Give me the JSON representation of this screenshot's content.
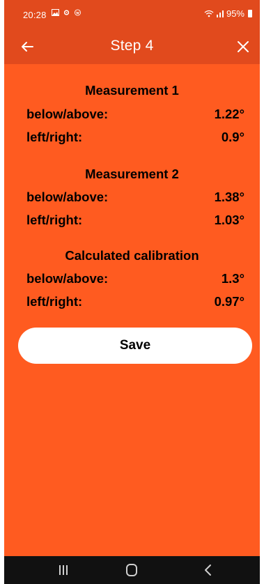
{
  "status_bar": {
    "time": "20:28",
    "battery": "95%"
  },
  "app_bar": {
    "title": "Step 4",
    "back_icon": "arrow-left-icon",
    "close_icon": "close-icon"
  },
  "measurements": [
    {
      "title": "Measurement 1",
      "rows": [
        {
          "label": "below/above:",
          "value": "1.22°"
        },
        {
          "label": "left/right:",
          "value": "0.9°"
        }
      ]
    },
    {
      "title": "Measurement 2",
      "rows": [
        {
          "label": "below/above:",
          "value": "1.38°"
        },
        {
          "label": "left/right:",
          "value": "1.03°"
        }
      ]
    },
    {
      "title": "Calculated calibration",
      "rows": [
        {
          "label": "below/above:",
          "value": "1.3°"
        },
        {
          "label": "left/right:",
          "value": "0.97°"
        }
      ]
    }
  ],
  "save_label": "Save",
  "colors": {
    "background": "#ff5b20",
    "app_bar": "#e14a1d",
    "nav_bar": "#111111",
    "button": "#ffffff"
  },
  "nav_bar": {
    "icons": [
      "recent-apps-icon",
      "home-icon",
      "back-icon"
    ]
  }
}
